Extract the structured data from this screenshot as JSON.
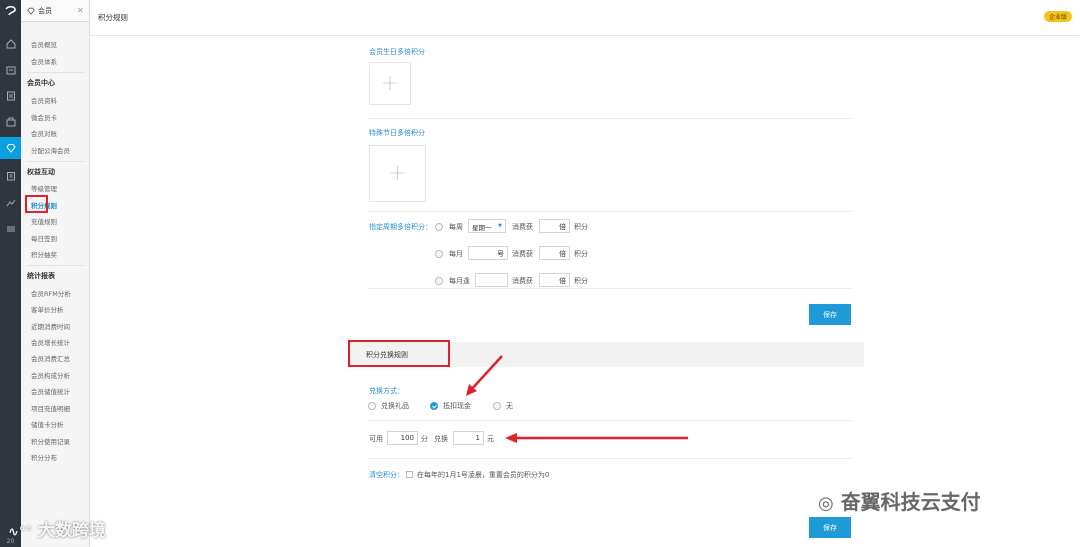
{
  "sidebar": {
    "header_label": "会员",
    "groups": [
      {
        "title": "",
        "items": [
          "会员概览",
          "会员体系"
        ]
      },
      {
        "title": "会员中心",
        "items": [
          "会员资料",
          "微会员卡",
          "会员对账",
          "分配公海会员"
        ]
      },
      {
        "title": "权益互动",
        "items": [
          "等级管理",
          "积分规则",
          "充值规则",
          "每日签到",
          "积分抽奖"
        ]
      },
      {
        "title": "统计报表",
        "items": [
          "会员RFM分析",
          "客单价分析",
          "近期消费时间",
          "会员增长统计",
          "会员消费汇总",
          "会员构成分析",
          "会员储值统计",
          "项目充值明细",
          "储值卡分析",
          "积分使用记录",
          "积分分布"
        ]
      }
    ],
    "active_item": "积分规则",
    "footer": "20"
  },
  "topbar": {
    "title": "积分规则",
    "edition_badge": "企业版"
  },
  "birthday": {
    "label": "会员生日多倍积分"
  },
  "holiday": {
    "label": "特殊节日多倍积分"
  },
  "period": {
    "label": "指定周期多倍积分：",
    "rows": [
      {
        "prefix": "每周",
        "select": "星期一",
        "unit": "",
        "consume": "消费获",
        "multiplier_unit": "倍",
        "points": "积分"
      },
      {
        "prefix": "每月",
        "input_suffix": "号",
        "consume": "消费获",
        "multiplier_unit": "倍",
        "points": "积分"
      },
      {
        "prefix": "每月逢",
        "consume": "消费获",
        "multiplier_unit": "倍",
        "points": "积分"
      }
    ]
  },
  "save_label": "保存",
  "exchange": {
    "section_title": "积分兑换规则",
    "method_label": "兑换方式：",
    "options": [
      "兑换礼品",
      "抵扣现金",
      "无"
    ],
    "selected": "抵扣现金",
    "available": "可用",
    "points_value": "100",
    "points_unit": "分",
    "exchange_word": "兑换",
    "cash_value": "1",
    "cash_unit": "元"
  },
  "clear": {
    "label": "清空积分：",
    "text": "在每年的1月1号凌晨，重置会员的积分为0"
  },
  "watermarks": {
    "wechat": "奋翼科技云支付",
    "brand": "大数跨境"
  },
  "colors": {
    "accent": "#1e9ad6",
    "highlight": "#e0202a",
    "rail": "#2f3640",
    "badge": "#f5c51a"
  }
}
